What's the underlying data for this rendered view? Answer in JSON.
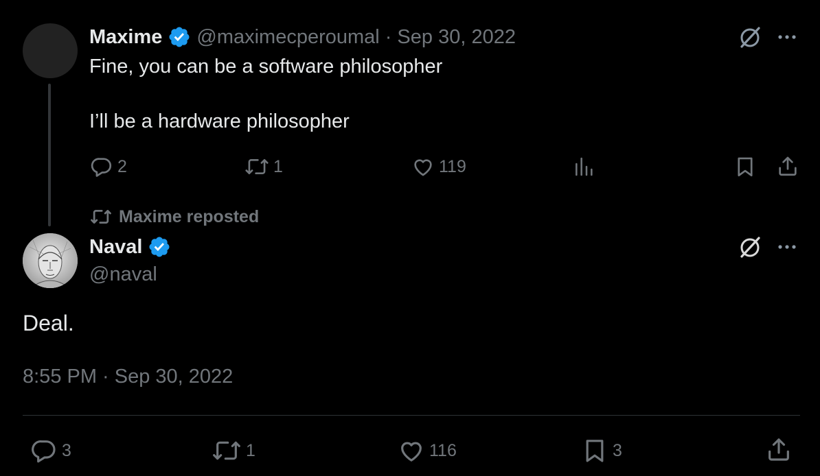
{
  "parent_tweet": {
    "author_name": "Maxime",
    "handle": "@maximecperoumal",
    "separator": "·",
    "date": "Sep 30, 2022",
    "text_line1": "Fine, you can be a software philosopher",
    "text_line2": "I’ll be a hardware philosopher",
    "replies": "2",
    "reposts": "1",
    "likes": "119"
  },
  "repost_label": "Maxime reposted",
  "main_tweet": {
    "author_name": "Naval",
    "handle": "@naval",
    "text": "Deal.",
    "timestamp": "8:55 PM · Sep 30, 2022",
    "replies": "3",
    "reposts": "1",
    "likes": "116",
    "bookmarks": "3"
  },
  "colors": {
    "background": "#000000",
    "text_primary": "#e7e9ea",
    "text_muted": "#71767b",
    "verified_blue": "#1d9bf0",
    "divider": "#2f3336"
  },
  "icons": [
    "reply-icon",
    "repost-icon",
    "like-icon",
    "views-icon",
    "bookmark-icon",
    "share-icon",
    "grok-icon",
    "more-icon",
    "verified-badge-icon"
  ]
}
